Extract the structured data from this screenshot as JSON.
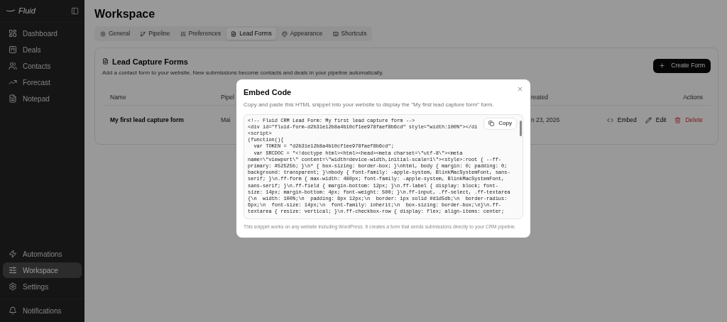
{
  "sidebar": {
    "logo": "Fluid",
    "items": [
      {
        "label": "Dashboard",
        "selected": false
      },
      {
        "label": "Deals",
        "selected": false
      },
      {
        "label": "Contacts",
        "selected": false
      },
      {
        "label": "Forecast",
        "selected": false
      },
      {
        "label": "Notepad",
        "selected": false
      }
    ],
    "bottom_items": [
      {
        "label": "Automations",
        "selected": false
      },
      {
        "label": "Workspace",
        "selected": true
      },
      {
        "label": "Settings",
        "selected": false
      }
    ],
    "notifications": "Notifications"
  },
  "page": {
    "title": "Workspace",
    "tabs": [
      {
        "label": "General",
        "selected": false
      },
      {
        "label": "Pipeline",
        "selected": false
      },
      {
        "label": "Preferences",
        "selected": false
      },
      {
        "label": "Lead Forms",
        "selected": true
      },
      {
        "label": "Appearance",
        "selected": false
      },
      {
        "label": "Shortcuts",
        "selected": false
      }
    ],
    "card": {
      "title": "Lead Capture Forms",
      "description": "Add a contact form to your website. New submissions become contacts and deals in your pipeline automatically.",
      "create_button": "Create Form",
      "table": {
        "columns": [
          "Name",
          "Pipel",
          "reated",
          "Actions"
        ],
        "rows": [
          {
            "name": "My first lead capture form",
            "pipeline": "Mai",
            "created": "n 23, 2026",
            "actions": [
              {
                "kind": "embed",
                "label": "Embed"
              },
              {
                "kind": "edit",
                "label": "Edit"
              },
              {
                "kind": "delete",
                "label": "Delete"
              }
            ]
          }
        ]
      }
    }
  },
  "dialog": {
    "title": "Embed Code",
    "description": "Copy and paste this HTML snippet into your website to display the \"My first lead capture form\" form.",
    "copy_button": "Copy",
    "code_lines": [
      "<!-- Fluid CRM Lead Form: My first lead capture form -->",
      "<div id=\"fluid-form-d2b31e12b8a4b10cf1ee978faef8b6cd\" style=\"width:100%\"></di",
      "<script>",
      "(function(){",
      "  var TOKEN = \"d2b31e12b8a4b10cf1ee978faef8b6cd\";",
      "  var SRCDOC = \"<!doctype html><html><head><meta charset=\\\"utf-8\\\"><meta",
      "name=\\\"viewport\\\" content=\\\"width=device-width,initial-scale=1\\\"><style>:root { --ff-",
      "primary: #52525b; }\\n* { box-sizing: border-box; }\\nhtml, body { margin: 0; padding: 0;",
      "background: transparent; }\\nbody { font-family: -apple-system, BlinkMacSystemFont, sans-",
      "serif; }\\n.ff-form { max-width: 480px; font-family: -apple-system, BlinkMacSystemFont,",
      "sans-serif; }\\n.ff-field { margin-bottom: 12px; }\\n.ff-label { display: block; font-",
      "size: 14px; margin-bottom: 4px; font-weight: 500; }\\n.ff-input, .ff-select, .ff-textarea",
      "{\\n  width: 100%;\\n  padding: 8px 12px;\\n  border: 1px solid #d1d5db;\\n  border-radius:",
      "6px;\\n  font-size: 14px;\\n  font-family: inherit;\\n  box-sizing: border-box;\\n}\\n.ff-",
      "textarea { resize: vertical; }\\n.ff-checkbox-row { display: flex; align-items: center;"
    ],
    "footer": "This snippet works on any website including WordPress. It creates a form that sends submissions directly to your CRM pipeline."
  }
}
